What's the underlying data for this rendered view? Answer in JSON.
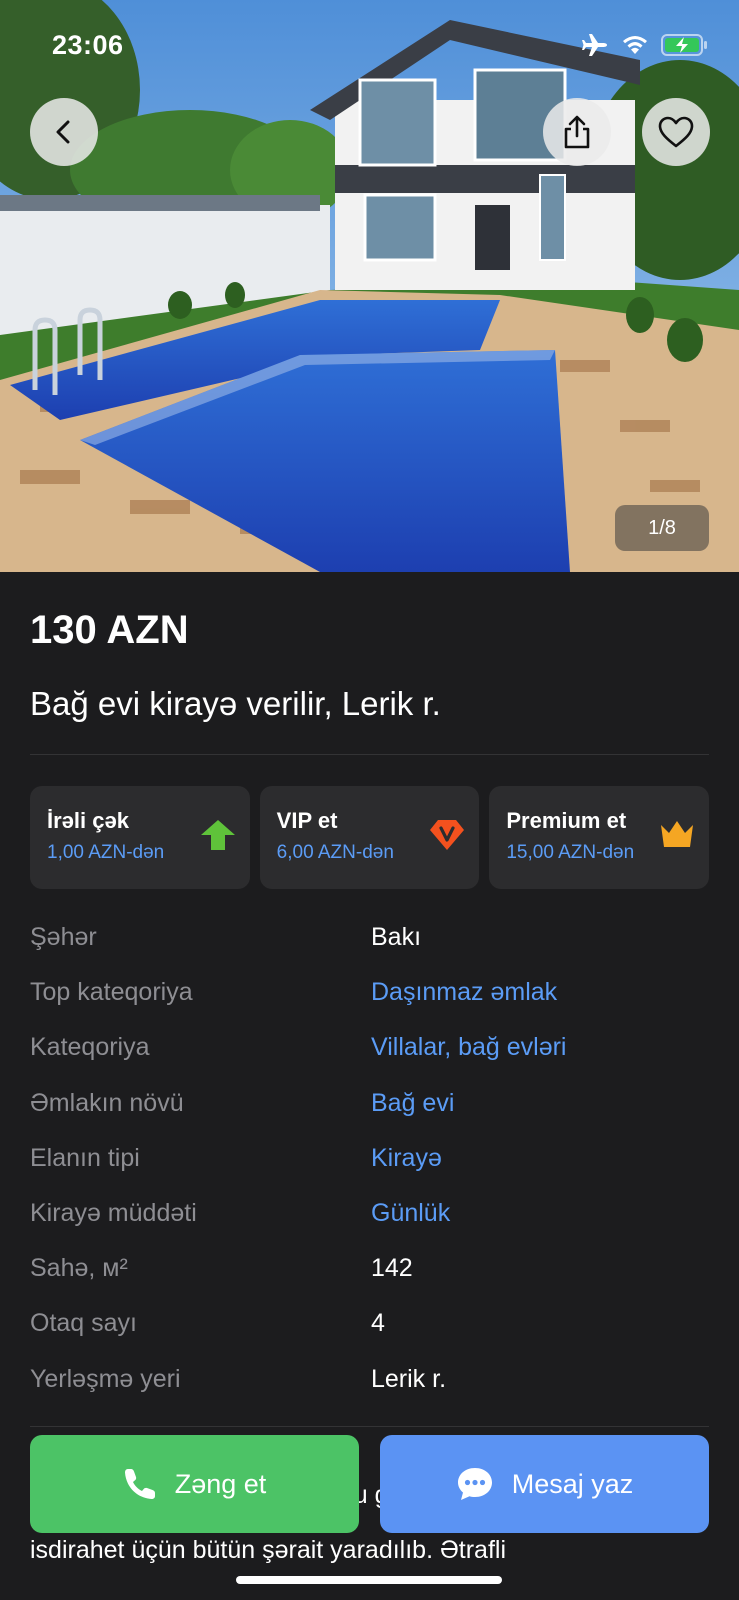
{
  "status_bar": {
    "time": "23:06"
  },
  "gallery": {
    "counter": "1/8"
  },
  "listing": {
    "price": "130 AZN",
    "title": "Bağ evi kirayə verilir, Lerik r."
  },
  "promotions": [
    {
      "title": "İrəli çək",
      "subtitle": "1,00 AZN-dən",
      "icon": "arrow-up-icon",
      "color": "#5fc33a"
    },
    {
      "title": "VIP et",
      "subtitle": "6,00 AZN-dən",
      "icon": "vip-badge-icon",
      "color": "#f4511e"
    },
    {
      "title": "Premium et",
      "subtitle": "15,00 AZN-dən",
      "icon": "crown-icon",
      "color": "#f5a623"
    }
  ],
  "properties": [
    {
      "label": "Şəhər",
      "value": "Bakı",
      "link": false
    },
    {
      "label": "Top kateqoriya",
      "value": "Daşınmaz əmlak",
      "link": true
    },
    {
      "label": "Kateqoriya",
      "value": "Villalar, bağ evləri",
      "link": true
    },
    {
      "label": "Əmlakın növü",
      "value": "Bağ evi",
      "link": true
    },
    {
      "label": "Elanın tipi",
      "value": "Kirayə",
      "link": true
    },
    {
      "label": "Kirayə müddəti",
      "value": "Günlük",
      "link": true
    },
    {
      "label": "Sahə, м²",
      "value": "142",
      "link": false
    },
    {
      "label": "Otaq sayı",
      "value": "4",
      "link": false
    },
    {
      "label": "Yerləşmə yeri",
      "value": "Lerik r.",
      "link": false
    }
  ],
  "description": {
    "line1": "bir Ailəm evimiz sizin yolunuzu gözləyir. Ailəmdə",
    "line2": "isdirahet üçün bütün şərait yaradılıb. Ətrafli"
  },
  "actions": {
    "call_label": "Zəng et",
    "message_label": "Mesaj yaz"
  },
  "colors": {
    "link": "#5b9cf6",
    "call": "#4cc366",
    "message": "#5b93f3",
    "background": "#1c1c1e"
  }
}
